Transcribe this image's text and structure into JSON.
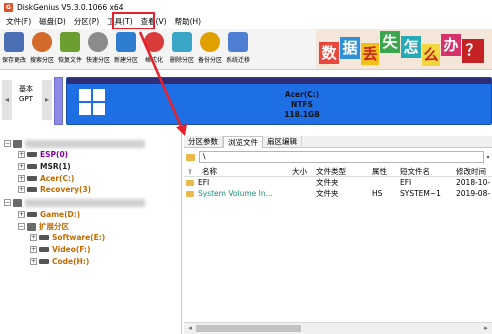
{
  "window": {
    "title": "DiskGenius V5.3.0.1066 x64",
    "app_icon_letter": "G"
  },
  "menu": [
    {
      "label": "文件(F)"
    },
    {
      "label": "磁盘(D)"
    },
    {
      "label": "分区(P)"
    },
    {
      "label": "工具(T)"
    },
    {
      "label": "查看(V)"
    },
    {
      "label": "帮助(H)"
    }
  ],
  "toolbar": [
    {
      "label": "保存更改",
      "icon": "save-icon",
      "color": "#4a6fb5"
    },
    {
      "label": "搜索分区",
      "icon": "search-icon",
      "color": "#d26a2a"
    },
    {
      "label": "恢复文件",
      "icon": "recover-icon",
      "color": "#6b9e2e"
    },
    {
      "label": "快速分区",
      "icon": "quick-partition-icon",
      "color": "#8b8b8b"
    },
    {
      "label": "新建分区",
      "icon": "new-partition-icon",
      "color": "#2f7dd1"
    },
    {
      "label": "格式化",
      "icon": "format-icon",
      "color": "#d93a3a"
    },
    {
      "label": "删除分区",
      "icon": "delete-icon",
      "color": "#3aa6c7"
    },
    {
      "label": "备份分区",
      "icon": "backup-icon",
      "color": "#e0a100"
    },
    {
      "label": "系统迁移",
      "icon": "migrate-icon",
      "color": "#4e7fd3"
    }
  ],
  "banner": {
    "tiles": [
      {
        "text": "数",
        "color": "#e9473c"
      },
      {
        "text": "据",
        "color": "#2d90d8"
      },
      {
        "text": "丢",
        "color": "#f1c11b"
      },
      {
        "text": "失",
        "color": "#3aa74e"
      },
      {
        "text": "怎",
        "color": "#27aab8"
      },
      {
        "text": "么",
        "color": "#f0d73f"
      },
      {
        "text": "办",
        "color": "#d6336c"
      },
      {
        "text": "？",
        "color": "#c52323"
      }
    ]
  },
  "disk": {
    "label_line1": "基本",
    "label_line2": "GPT",
    "partition_name": "Acer(C:)",
    "partition_fs": "NTFS",
    "partition_size": "118.1GB"
  },
  "tree": {
    "esp": "ESP(0)",
    "msr": "MSR(1)",
    "acer": "Acer(C:)",
    "recovery": "Recovery(3)",
    "game": "Game(D:)",
    "extended": "扩展分区",
    "software": "Software(E:)",
    "video": "Video(F:)",
    "code": "Code(H:)"
  },
  "tabs": [
    {
      "label": "分区参数",
      "active": false
    },
    {
      "label": "浏览文件",
      "active": true
    },
    {
      "label": "扇区编辑",
      "active": false
    }
  ],
  "path": {
    "value": "\\"
  },
  "filelist": {
    "columns": {
      "name": "名称",
      "size": "大小",
      "type": "文件类型",
      "attr": "属性",
      "short": "短文件名",
      "mtime": "修改时间"
    },
    "rows": [
      {
        "name": "EFI",
        "size": "",
        "type": "文件夹",
        "attr": "",
        "short": "EFI",
        "mtime": "2018-10-"
      },
      {
        "name": "System Volume In...",
        "size": "",
        "type": "文件夹",
        "attr": "HS",
        "short": "SYSTEM~1",
        "mtime": "2019-08-"
      }
    ]
  },
  "colors": {
    "highlight": "#e8202a",
    "partition_blue": "#1f6fe4"
  }
}
